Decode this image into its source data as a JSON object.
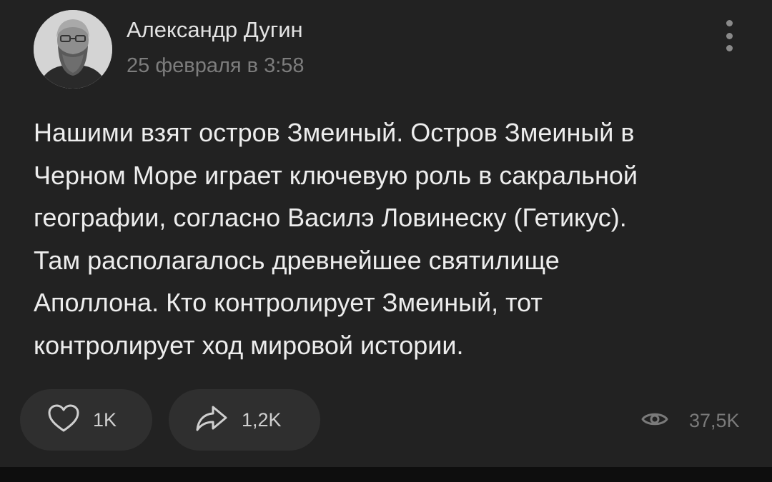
{
  "post": {
    "author_name": "Александр Дугин",
    "date": "25 февраля в 3:58",
    "text_lines": [
      "Нашими взят остров Змеиный. Остров Змеиный в",
      "Черном Море играет ключевую роль в сакральной",
      "географии, согласно Василэ Ловинеску (Гетикус).",
      "Там располагалось древнейшее святилище",
      "Аполлона. Кто контролирует Змеиный, тот",
      "контролирует ход мировой истории."
    ]
  },
  "actions": {
    "likes": "1K",
    "shares": "1,2K",
    "views": "37,5K"
  },
  "icons": {
    "like": "heart-icon",
    "share": "share-arrow-icon",
    "views": "eye-icon",
    "menu": "more-vertical-icon"
  },
  "colors": {
    "post_background": "#222222",
    "button_background": "#2f2f2f",
    "primary_text": "#ededed",
    "secondary_text": "#7d7d7d"
  }
}
